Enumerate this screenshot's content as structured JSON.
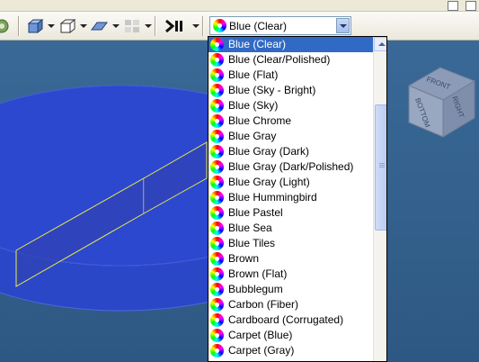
{
  "toolbar": {
    "selected_material": "Blue (Clear)",
    "icons": [
      "viewer-icon",
      "box-view-icon",
      "wireframe-box-icon",
      "plane-icon",
      "grid-icon",
      "render-icon"
    ]
  },
  "material_list": [
    "Blue (Clear)",
    "Blue (Clear/Polished)",
    "Blue (Flat)",
    "Blue (Sky - Bright)",
    "Blue (Sky)",
    "Blue Chrome",
    "Blue Gray",
    "Blue Gray (Dark)",
    "Blue Gray (Dark/Polished)",
    "Blue Gray (Light)",
    "Blue Hummingbird",
    "Blue Pastel",
    "Blue Sea",
    "Blue Tiles",
    "Brown",
    "Brown (Flat)",
    "Bubblegum",
    "Carbon (Fiber)",
    "Cardboard (Corrugated)",
    "Carpet (Blue)",
    "Carpet (Gray)"
  ],
  "viewcube": {
    "faces": [
      "FRONT",
      "RIGHT",
      "BOTTOM"
    ]
  },
  "colors": {
    "viewport_bg": "#2e5f8e",
    "selection": "#316ac5",
    "disk_fill": "#2946c9",
    "sketch_line": "#e8e84a"
  }
}
